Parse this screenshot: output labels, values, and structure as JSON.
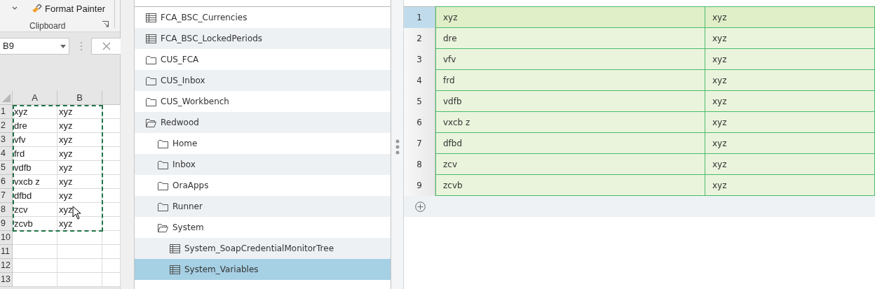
{
  "excel": {
    "ribbon": {
      "format_painter": "Format Painter",
      "group_label": "Clipboard"
    },
    "name_box": "B9",
    "columns": [
      "A",
      "B"
    ],
    "rows": [
      {
        "number": "1",
        "cells": [
          "xyz",
          "xyz"
        ]
      },
      {
        "number": "2",
        "cells": [
          "dre",
          "xyz"
        ]
      },
      {
        "number": "3",
        "cells": [
          "vfv",
          "xyz"
        ]
      },
      {
        "number": "4",
        "cells": [
          "frd",
          "xyz"
        ]
      },
      {
        "number": "5",
        "cells": [
          "vdfb",
          "xyz"
        ]
      },
      {
        "number": "6",
        "cells": [
          "vxcb z",
          "xyz"
        ]
      },
      {
        "number": "7",
        "cells": [
          "dfbd",
          "xyz"
        ]
      },
      {
        "number": "8",
        "cells": [
          "zcv",
          "xyz"
        ]
      },
      {
        "number": "9",
        "cells": [
          "zcvb",
          "xyz"
        ]
      },
      {
        "number": "10"
      },
      {
        "number": "11"
      },
      {
        "number": "12"
      },
      {
        "number": "13"
      }
    ]
  },
  "tree": {
    "items": [
      {
        "kind": "table",
        "label": "FCA_BSC_Currencies",
        "selected": false
      },
      {
        "kind": "table",
        "label": "FCA_BSC_LockedPeriods",
        "selected": false
      },
      {
        "kind": "folder",
        "label": "CUS_FCA",
        "expanded": false,
        "selected": false
      },
      {
        "kind": "folder",
        "label": "CUS_Inbox",
        "expanded": false,
        "selected": false
      },
      {
        "kind": "folder",
        "label": "CUS_Workbench",
        "expanded": false,
        "selected": false
      },
      {
        "kind": "folder",
        "label": "Redwood",
        "expanded": true,
        "selected": false,
        "children": [
          {
            "kind": "folder",
            "label": "Home",
            "expanded": false,
            "selected": false
          },
          {
            "kind": "folder",
            "label": "Inbox",
            "expanded": false,
            "selected": false
          },
          {
            "kind": "folder",
            "label": "OraApps",
            "expanded": false,
            "selected": false
          },
          {
            "kind": "folder",
            "label": "Runner",
            "expanded": false,
            "selected": false
          },
          {
            "kind": "folder",
            "label": "System",
            "expanded": true,
            "selected": false,
            "children": [
              {
                "kind": "table",
                "label": "System_SoapCredentialMonitorTree",
                "selected": false
              },
              {
                "kind": "table",
                "label": "System_Variables",
                "selected": true
              }
            ]
          }
        ]
      }
    ]
  },
  "grid": {
    "rows": [
      {
        "number": "1",
        "selected": true,
        "cells": [
          "xyz",
          "xyz"
        ]
      },
      {
        "number": "2",
        "selected": false,
        "cells": [
          "dre",
          "xyz"
        ]
      },
      {
        "number": "3",
        "selected": false,
        "cells": [
          "vfv",
          "xyz"
        ]
      },
      {
        "number": "4",
        "selected": false,
        "cells": [
          "frd",
          "xyz"
        ]
      },
      {
        "number": "5",
        "selected": false,
        "cells": [
          "vdfb",
          "xyz"
        ]
      },
      {
        "number": "6",
        "selected": false,
        "cells": [
          "vxcb z",
          "xyz"
        ]
      },
      {
        "number": "7",
        "selected": false,
        "cells": [
          "dfbd",
          "xyz"
        ]
      },
      {
        "number": "8",
        "selected": false,
        "cells": [
          "zcv",
          "xyz"
        ]
      },
      {
        "number": "9",
        "selected": false,
        "cells": [
          "zcvb",
          "xyz"
        ]
      }
    ]
  }
}
